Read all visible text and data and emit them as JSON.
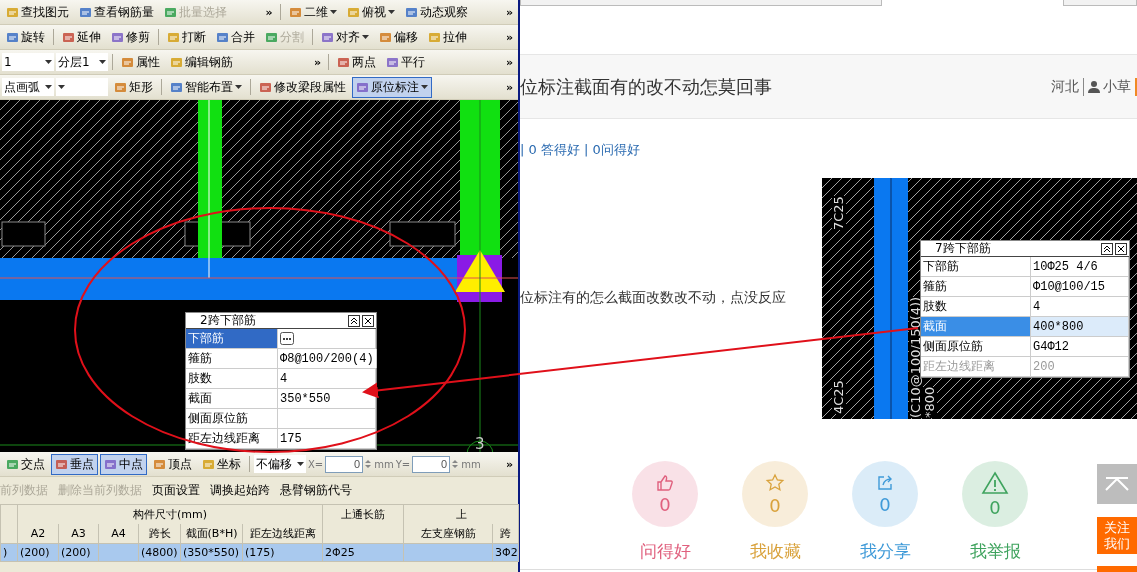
{
  "cad_window": {
    "toolbars": [
      [
        {
          "kind": "button",
          "label": "查找图元",
          "pressed": false,
          "disabled": false
        },
        {
          "kind": "button",
          "label": "查看钢筋量",
          "pressed": false,
          "disabled": false
        },
        {
          "kind": "button",
          "label": "批量选择",
          "pressed": false,
          "disabled": true
        },
        {
          "kind": "more",
          "label": "»"
        },
        {
          "kind": "separator"
        },
        {
          "kind": "dropdown",
          "label": "二维",
          "pressed": false,
          "disabled": false
        },
        {
          "kind": "dropdown",
          "label": "俯视",
          "pressed": false,
          "disabled": false
        },
        {
          "kind": "button",
          "label": "动态观察",
          "pressed": false,
          "disabled": false
        },
        {
          "kind": "more",
          "label": "»"
        }
      ],
      [
        {
          "kind": "button",
          "label": "旋转",
          "pressed": false,
          "disabled": false
        },
        {
          "kind": "separator"
        },
        {
          "kind": "button",
          "label": "延伸",
          "pressed": false,
          "disabled": false
        },
        {
          "kind": "button",
          "label": "修剪",
          "pressed": false,
          "disabled": false
        },
        {
          "kind": "separator"
        },
        {
          "kind": "button",
          "label": "打断",
          "pressed": false,
          "disabled": false
        },
        {
          "kind": "button",
          "label": "合并",
          "pressed": false,
          "disabled": false
        },
        {
          "kind": "button",
          "label": "分割",
          "pressed": false,
          "disabled": true
        },
        {
          "kind": "separator"
        },
        {
          "kind": "dropdown",
          "label": "对齐",
          "pressed": false,
          "disabled": false
        },
        {
          "kind": "button",
          "label": "偏移",
          "pressed": false,
          "disabled": false
        },
        {
          "kind": "button",
          "label": "拉伸",
          "pressed": false,
          "disabled": false
        },
        {
          "kind": "more",
          "label": "»"
        }
      ],
      [
        {
          "kind": "select",
          "label": "1"
        },
        {
          "kind": "select",
          "label": "分层1"
        },
        {
          "kind": "separator"
        },
        {
          "kind": "button",
          "label": "属性",
          "pressed": false,
          "disabled": false
        },
        {
          "kind": "button",
          "label": "编辑钢筋",
          "pressed": false,
          "disabled": false
        },
        {
          "kind": "more",
          "label": "»"
        },
        {
          "kind": "separator"
        },
        {
          "kind": "button",
          "label": "两点",
          "pressed": false,
          "disabled": false
        },
        {
          "kind": "button",
          "label": "平行",
          "pressed": false,
          "disabled": false
        },
        {
          "kind": "more",
          "label": "»"
        }
      ],
      [
        {
          "kind": "select",
          "label": "点画弧"
        },
        {
          "kind": "select"
        },
        {
          "kind": "button",
          "label": "矩形",
          "pressed": false,
          "disabled": false
        },
        {
          "kind": "separator"
        },
        {
          "kind": "dropdown",
          "label": "智能布置",
          "pressed": false,
          "disabled": false
        },
        {
          "kind": "separator"
        },
        {
          "kind": "button",
          "label": "修改梁段属性",
          "pressed": false,
          "disabled": false
        },
        {
          "kind": "dropdown",
          "label": "原位标注",
          "pressed": true,
          "disabled": false
        },
        {
          "kind": "more",
          "label": "»"
        }
      ]
    ],
    "canvas": {
      "axis_label": "3",
      "popup": {
        "title": "2跨下部筋",
        "rows": [
          {
            "label": "下部筋",
            "selected": true,
            "browse": true,
            "disabled": false
          },
          {
            "label": "箍筋",
            "value": "Φ8@100/200(4)",
            "selected": false,
            "browse": false,
            "disabled": false
          },
          {
            "label": "肢数",
            "value": "4",
            "selected": false,
            "browse": false,
            "disabled": false
          },
          {
            "label": "截面",
            "value": "350*550",
            "selected": false,
            "browse": false,
            "disabled": false
          },
          {
            "label": "侧面原位筋",
            "selected": false,
            "browse": false,
            "disabled": false
          },
          {
            "label": "距左边线距离",
            "value": "175",
            "selected": false,
            "browse": false,
            "disabled": false
          }
        ]
      }
    },
    "snap_toolbar": [
      {
        "kind": "button",
        "label": "交点",
        "pressed": false,
        "disabled": false
      },
      {
        "kind": "button",
        "label": "垂点",
        "pressed": true,
        "disabled": false
      },
      {
        "kind": "button",
        "label": "中点",
        "pressed": true,
        "disabled": false
      },
      {
        "kind": "button",
        "label": "顶点",
        "pressed": false,
        "disabled": false
      },
      {
        "kind": "button",
        "label": "坐标",
        "pressed": false,
        "disabled": false
      },
      {
        "kind": "separator"
      },
      {
        "kind": "select",
        "label": "不偏移"
      },
      {
        "kind": "coord",
        "label": "X=",
        "value": "0",
        "unit": "mm"
      },
      {
        "kind": "coord",
        "label": "Y=",
        "value": "0",
        "unit": "mm"
      },
      {
        "kind": "more",
        "label": "»"
      }
    ],
    "menu": [
      {
        "label": "前列数据",
        "disabled": true
      },
      {
        "label": "删除当前列数据",
        "disabled": true
      },
      {
        "label": "页面设置",
        "disabled": false
      },
      {
        "label": "调换起始跨",
        "disabled": false
      },
      {
        "label": "悬臂钢筋代号",
        "disabled": false
      }
    ],
    "table": {
      "groups": [
        "构件尺寸(mm)",
        "上通长筋",
        "上"
      ],
      "columns": [
        "",
        "A2",
        "A3",
        "A4",
        "跨长",
        "截面(B*H)",
        "距左边线距离",
        "",
        "左支座钢筋",
        "跨"
      ],
      "rows": [
        {
          "selected": true,
          "cells": [
            ")",
            "(200)",
            "(200)",
            null,
            "(4800)",
            "(350*550)",
            "(175)",
            "2Φ25",
            null,
            "3Φ2"
          ]
        }
      ]
    }
  },
  "web": {
    "title": "位标注截面有的改不动怎莫回事",
    "location": "河北",
    "user": "小草",
    "stats": "| 0 答得好 | 0问得好",
    "body": "位标注有的怎么截面改数改不动，点没反应",
    "image": {
      "labels": [
        {
          "text": "7C25",
          "kind": "top"
        },
        {
          "text": "4C25",
          "kind": "bottom"
        },
        {
          "text": "(C10@100/150(4))",
          "kind": "stirrup"
        },
        {
          "text": "*800",
          "kind": "section"
        }
      ],
      "popup": {
        "title": "7跨下部筋",
        "rows": [
          {
            "label": "下部筋",
            "value": "10Φ25 4/6",
            "selected": false,
            "disabled": false
          },
          {
            "label": "箍筋",
            "value": "Φ10@100/15",
            "selected": false,
            "disabled": false
          },
          {
            "label": "肢数",
            "value": "4",
            "selected": false,
            "disabled": false
          },
          {
            "label": "截面",
            "value": "400*800",
            "selected": true,
            "disabled": false
          },
          {
            "label": "侧面原位筋",
            "value": "G4Φ12",
            "selected": false,
            "disabled": false
          },
          {
            "label": "距左边线距离",
            "value": "200",
            "selected": false,
            "disabled": true
          }
        ]
      }
    },
    "actions": [
      {
        "kind": "like",
        "count": "0",
        "label": "问得好",
        "color": "#e0607e"
      },
      {
        "kind": "star",
        "count": "0",
        "label": "我收藏",
        "color": "#d9a23c"
      },
      {
        "kind": "share",
        "count": "0",
        "label": "我分享",
        "color": "#3f9ad8"
      },
      {
        "kind": "report",
        "count": "0",
        "label": "我举报",
        "color": "#3fa35e"
      }
    ],
    "follow": "关注我们"
  }
}
